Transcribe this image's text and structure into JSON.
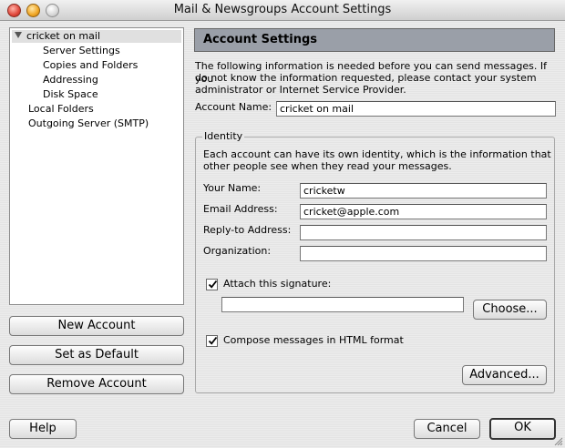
{
  "window": {
    "title": "Mail & Newsgroups Account Settings"
  },
  "tree": {
    "account": "cricket on mail",
    "children": [
      "Server Settings",
      "Copies and Folders",
      "Addressing",
      "Disk Space"
    ],
    "others": [
      "Local Folders",
      "Outgoing Server (SMTP)"
    ]
  },
  "left_buttons": {
    "new_account": "New Account",
    "set_default": "Set as Default",
    "remove_account": "Remove Account"
  },
  "panel": {
    "heading": "Account Settings",
    "intro_lines": [
      "The following information is needed before you can send messages. If you",
      "do not know the information requested, please contact your system",
      "administrator or Internet Service Provider."
    ],
    "account_name_label": "Account Name:",
    "account_name_value": "cricket on mail"
  },
  "identity": {
    "legend": "Identity",
    "desc_lines": [
      "Each account can have its own identity, which is the information that",
      "other people see when they read your messages."
    ],
    "your_name_label": "Your Name:",
    "your_name_value": "cricketw",
    "email_label": "Email Address:",
    "email_value": "cricket@apple.com",
    "reply_to_label": "Reply-to Address:",
    "reply_to_value": "",
    "organization_label": "Organization:",
    "organization_value": "",
    "attach_signature_label": "Attach this signature:",
    "attach_signature_checked": true,
    "signature_path": "",
    "choose_button": "Choose...",
    "compose_html_label": "Compose messages in HTML format",
    "compose_html_checked": true,
    "advanced_button": "Advanced..."
  },
  "bottom": {
    "help": "Help",
    "cancel": "Cancel",
    "ok": "OK"
  }
}
